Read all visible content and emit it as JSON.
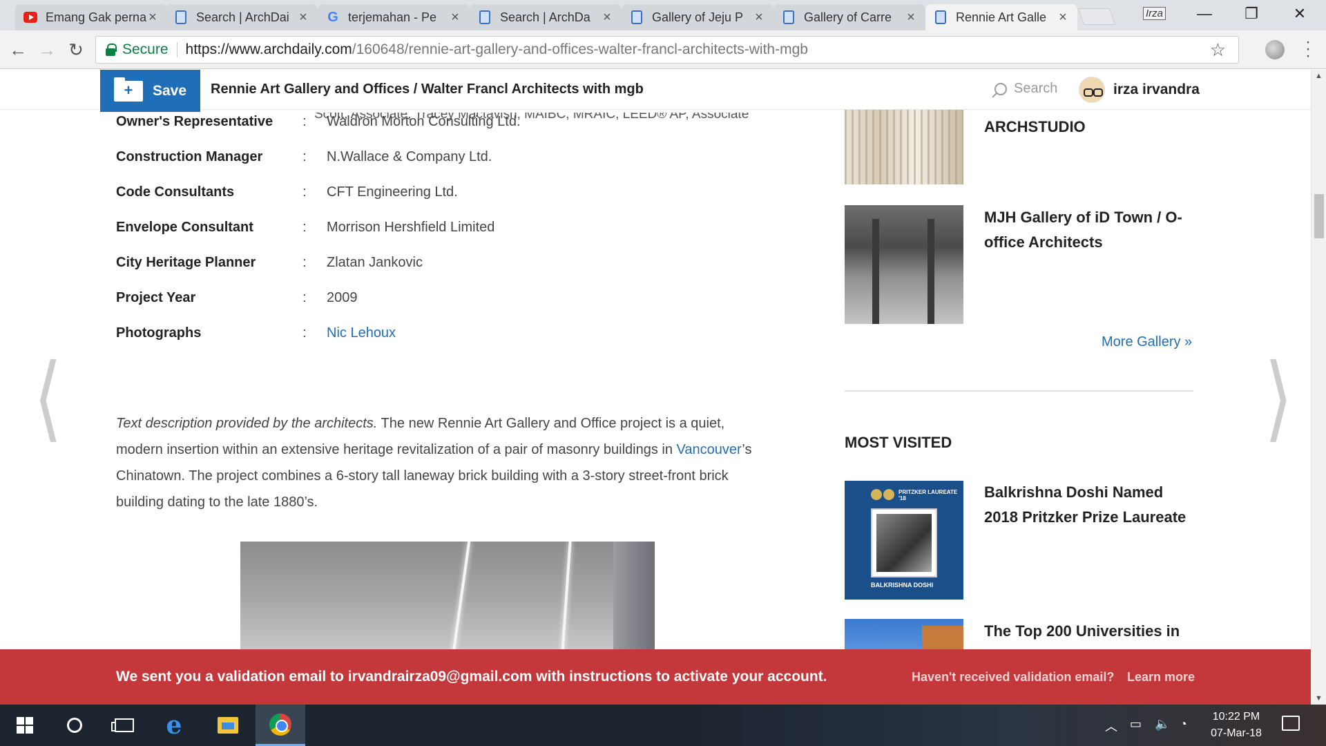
{
  "browser": {
    "tabs": [
      {
        "title": "Emang Gak perna",
        "icon": "youtube-icon"
      },
      {
        "title": "Search | ArchDai",
        "icon": "archdaily-icon"
      },
      {
        "title": "terjemahan - Pe",
        "icon": "google-icon"
      },
      {
        "title": "Search | ArchDa",
        "icon": "archdaily-icon"
      },
      {
        "title": "Gallery of Jeju P",
        "icon": "archdaily-icon"
      },
      {
        "title": "Gallery of Carre",
        "icon": "archdaily-icon"
      },
      {
        "title": "Rennie Art Galle",
        "icon": "archdaily-icon",
        "active": true
      }
    ],
    "profile_badge": "Irza",
    "address": {
      "secure_label": "Secure",
      "url_host": "https://www.archdaily.com",
      "url_path": "/160648/rennie-art-gallery-and-offices-walter-francl-architects-with-mgb"
    }
  },
  "header": {
    "save_label": "Save",
    "title": "Rennie Art Gallery and Offices / Walter Francl Architects with mgb",
    "search_placeholder": "Search",
    "user_name": "irza irvandra"
  },
  "article": {
    "partial_line": "Scott, Associate; Tracey Mactavish, MAIBC, MRAIC, LEED® AP, Associate",
    "specs": [
      {
        "label": "Owner's Representative",
        "value": "Waldron Morton Consulting Ltd."
      },
      {
        "label": "Construction Manager",
        "value": "N.Wallace & Company Ltd."
      },
      {
        "label": "Code Consultants",
        "value": "CFT Engineering Ltd."
      },
      {
        "label": "Envelope Consultant",
        "value": "Morrison Hershfield Limited"
      },
      {
        "label": "City Heritage Planner",
        "value": "Zlatan Jankovic"
      },
      {
        "label": "Project Year",
        "value": "2009"
      },
      {
        "label": "Photographs",
        "value": "Nic Lehoux",
        "link": true
      }
    ],
    "spec_colon": ":",
    "description": {
      "intro_italic": "Text description provided by the architects.",
      "part1": " The new Rennie Art Gallery and Office project is a quiet, modern insertion within an extensive heritage revitalization of a pair of masonry buildings in ",
      "link": "Vancouver",
      "part2": "’s Chinatown. The project combines a 6-story tall laneway brick building with a 3-story street-front brick building dating to the late 1880’s."
    }
  },
  "sidebar": {
    "gallery_items": [
      {
        "title": "ARCHSTUDIO"
      },
      {
        "title": "MJH Gallery of iD Town / O-office Architects"
      }
    ],
    "more_gallery": "More Gallery »",
    "most_visited_heading": "MOST VISITED",
    "most_visited": [
      {
        "title": "Balkrishna Doshi Named 2018 Pritzker Prize Laureate",
        "thumb_text_top": "PRITZKER LAUREATE '18",
        "thumb_text_bottom": "BALKRISHNA DOSHI"
      },
      {
        "title": "The Top 200 Universities in"
      }
    ]
  },
  "banner": {
    "message": "We sent you a validation email to irvandrairza09@gmail.com with instructions to activate your account.",
    "link_resend": "Haven't received validation email?",
    "link_learn": "Learn more"
  },
  "taskbar": {
    "time": "10:22 PM",
    "date": "07-Mar-18"
  },
  "colors": {
    "accent": "#1f6eb7",
    "banner": "#c4373a",
    "secure": "#0b8043"
  }
}
